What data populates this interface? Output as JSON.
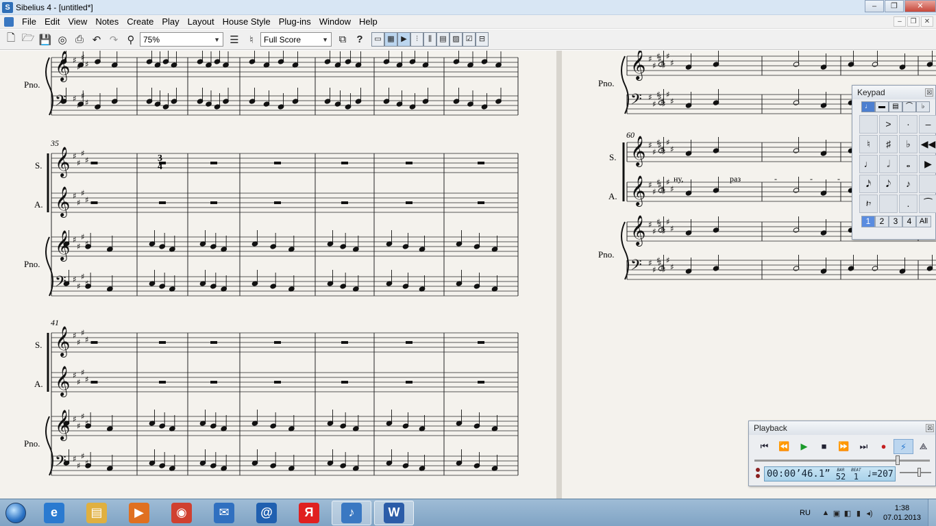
{
  "window": {
    "title": "Sibelius 4 - [untitled*]",
    "minimize": "‒",
    "maximize": "❐",
    "close": "✕"
  },
  "menu": [
    "File",
    "Edit",
    "View",
    "Notes",
    "Create",
    "Play",
    "Layout",
    "House Style",
    "Plug-ins",
    "Window",
    "Help"
  ],
  "toolbar": {
    "zoom": "75%",
    "view": "Full Score",
    "help": "?"
  },
  "score": {
    "bar_numbers": [
      "35",
      "41",
      "60"
    ],
    "labels": {
      "soprano": "S.",
      "alto": "A.",
      "piano": "Pno."
    },
    "lyrics": [
      "ну,",
      "раз",
      "-",
      "-",
      "-"
    ],
    "time_sig": {
      "top": "3",
      "bottom": "4"
    }
  },
  "keypad": {
    "title": "Keypad",
    "close": "☒",
    "tabs": [
      "♩",
      "▬",
      "▤",
      "⌒",
      "♭"
    ],
    "grid": [
      "",
      ">",
      "·",
      "–",
      "♮",
      "♯",
      "♭",
      "◀◀",
      "♩",
      "𝅗𝅥",
      "𝅝",
      "▶",
      "𝅘𝅥𝅯",
      "𝅘𝅥𝅮",
      "♪",
      "",
      "𝄽𝄾",
      "",
      ".",
      "⁀"
    ],
    "layers": [
      "1",
      "2",
      "3",
      "4",
      "All"
    ]
  },
  "playback": {
    "title": "Playback",
    "close": "☒",
    "buttons": [
      "⏮",
      "⏪",
      "▶",
      "■",
      "⏩",
      "⏭",
      "●",
      "⚡",
      "⟁"
    ],
    "time": "00:00’46.1”",
    "bar_label": "BAR",
    "bar": "52",
    "beat_label": "BEAT",
    "beat": "1",
    "tempo": "♩=207"
  },
  "taskbar": {
    "apps": [
      {
        "name": "internet-explorer",
        "glyph": "e",
        "color": "#2a7ad0"
      },
      {
        "name": "file-explorer",
        "glyph": "▤",
        "color": "#e0b040"
      },
      {
        "name": "media-player",
        "glyph": "▶",
        "color": "#e07020"
      },
      {
        "name": "chrome",
        "glyph": "◉",
        "color": "#d04030"
      },
      {
        "name": "mail",
        "glyph": "✉",
        "color": "#3070c0"
      },
      {
        "name": "mail-ru-agent",
        "glyph": "@",
        "color": "#2060b0"
      },
      {
        "name": "yandex",
        "glyph": "Я",
        "color": "#e02020"
      },
      {
        "name": "sibelius",
        "glyph": "♪",
        "color": "#3a78c2"
      },
      {
        "name": "word",
        "glyph": "W",
        "color": "#2b5ca8"
      }
    ],
    "lang": "RU",
    "time": "1:38",
    "date": "07.01.2013"
  }
}
